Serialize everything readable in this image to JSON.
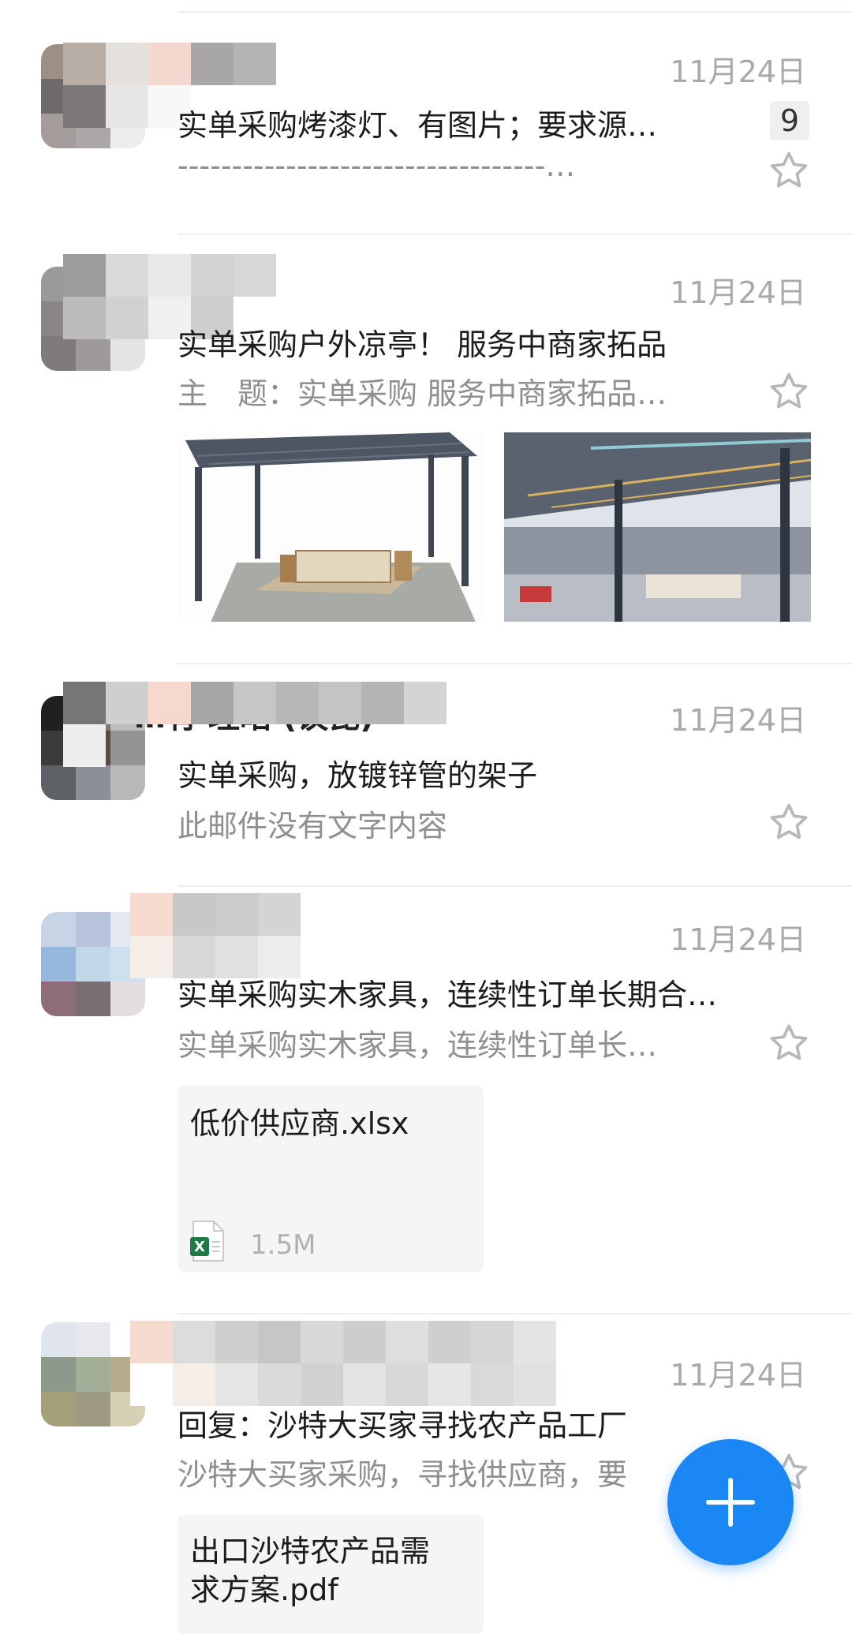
{
  "messages": [
    {
      "date": "11月24日",
      "subject": "实单采购烤漆灯、有图片；要求源…",
      "preview": "----------------------------------…",
      "badge": "9"
    },
    {
      "date": "11月24日",
      "subject": "实单采购户外凉亭！ 服务中商家拓品",
      "preview": "主　题：实单采购 服务中商家拓品…"
    },
    {
      "sender_fragment": "…有 理昭 (议昆)",
      "date": "11月24日",
      "subject": "实单采购，放镀锌管的架子",
      "preview": "此邮件没有文字内容"
    },
    {
      "date": "11月24日",
      "subject": "实单采购实木家具，连续性订单长期合…",
      "preview": "实单采购实木家具，连续性订单长…",
      "attachment": {
        "name": "低价供应商.xlsx",
        "size": "1.5M"
      }
    },
    {
      "date": "11月24日",
      "subject": "回复：沙特大买家寻找农产品工厂",
      "preview": "沙特大买家采购，寻找供应商，要",
      "attachment": {
        "name_line1": "出口沙特农产品需",
        "name_line2": "求方案.pdf"
      }
    }
  ],
  "icons": {
    "star": "star-outline-icon",
    "fab": "plus-icon",
    "attachment_excel": "excel-file-icon"
  },
  "colors": {
    "accent": "#1b87f5",
    "date": "#a9a9a9",
    "preview": "#8f8f8f"
  }
}
